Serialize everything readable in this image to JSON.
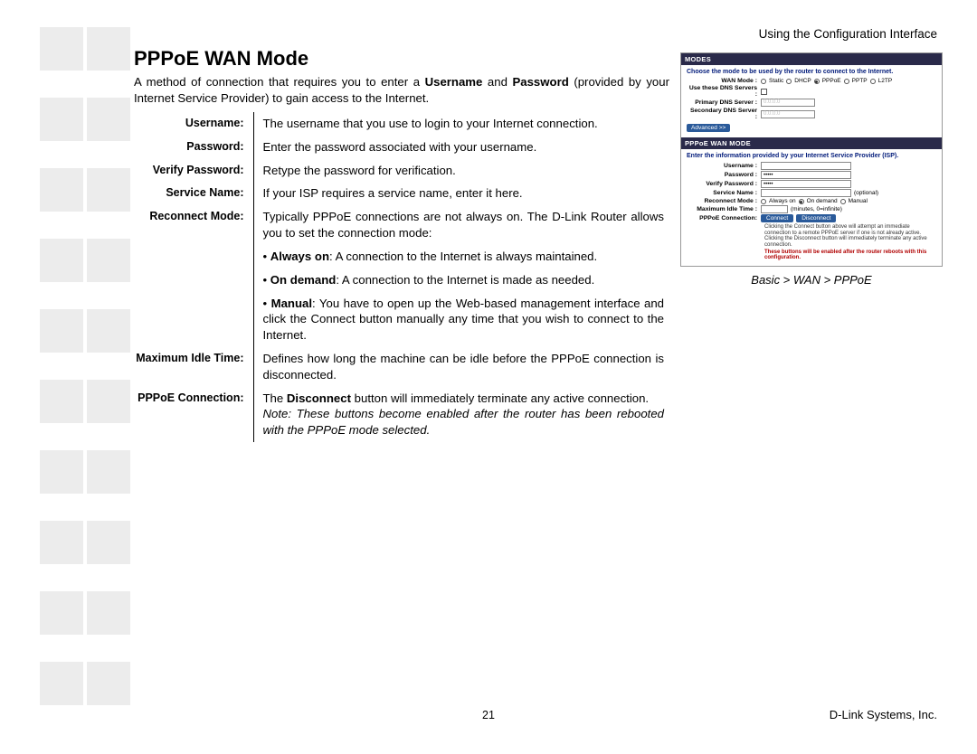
{
  "header": {
    "section": "Using the Configuration Interface"
  },
  "title": "PPPoE WAN Mode",
  "intro_parts": {
    "a": "A method of connection that requires you to enter a ",
    "b": "Username",
    "c": " and ",
    "d": "Password",
    "e": " (provided by your Internet Service Provider) to gain access to the Internet."
  },
  "defs": {
    "username": {
      "label": "Username:",
      "val": "The username that you use to login to your Internet connection."
    },
    "password": {
      "label": "Password:",
      "val": "Enter the password associated with your username."
    },
    "verify": {
      "label": "Verify Password:",
      "val": "Retype the password for verification."
    },
    "service": {
      "label": "Service Name:",
      "val": "If your ISP requires a service name, enter it here."
    },
    "reconnect": {
      "label": "Reconnect Mode:",
      "intro": "Typically PPPoE connections are not always on. The D-Link Router allows you to set the connection mode:",
      "b1_label": "Always on",
      "b1_text": ": A connection to the Internet is always maintained.",
      "b2_label": "On demand",
      "b2_text": ": A connection to the Internet is made as needed.",
      "b3_label": "Manual",
      "b3_text": ": You have to open up the Web-based management interface and click the Connect button manually any time that you wish to connect to the Internet."
    },
    "idle": {
      "label": "Maximum Idle Time:",
      "val": "Defines how long the machine can be idle before the PPPoE connection is disconnected."
    },
    "conn": {
      "label": "PPPoE Connection:",
      "a": "The ",
      "b": "Disconnect",
      "c": " button will immediately terminate any active connection.",
      "note": "Note: These buttons become enabled after the router has been rebooted with the PPPoE mode selected."
    }
  },
  "shot": {
    "modes_title": "MODES",
    "modes_instr": "Choose the mode to be used by the router to connect to the Internet.",
    "wan_mode_label": "WAN Mode :",
    "wan_options": {
      "static": "Static",
      "dhcp": "DHCP",
      "pppoe": "PPPoE",
      "pptp": "PPTP",
      "l2tp": "L2TP"
    },
    "use_dns_label": "Use these DNS Servers :",
    "pdns_label": "Primary DNS Server :",
    "sdns_label": "Secondary DNS Server :",
    "pdns_val": "0.0.0.0",
    "sdns_val": "0.0.0.0",
    "advanced": "Advanced >>",
    "pppoe_title": "PPPoE WAN MODE",
    "pppoe_instr": "Enter the information provided by your Internet Service Provider (ISP).",
    "f_user": "Username :",
    "f_pass": "Password :",
    "f_vpass": "Verify Password :",
    "f_svc": "Service Name :",
    "f_svc_hint": "(optional)",
    "f_reconnect": "Reconnect Mode :",
    "r_always": "Always on",
    "r_ondemand": "On demand",
    "r_manual": "Manual",
    "f_idle": "Maximum Idle Time :",
    "f_idle_hint": "(minutes, 0=infinite)",
    "f_conn": "PPPoE Connection:",
    "btn_connect": "Connect",
    "btn_disconnect": "Disconnect",
    "foot_note": "Clicking the Connect button above will attempt an immediate connection to a remote PPPoE server if one is not already active. Clicking the Disconnect button will immediately terminate any active connection.",
    "foot_warn": "These buttons will be enabled after the router reboots with this configuration.",
    "pass_mask": "•••••"
  },
  "caption": "Basic > WAN > PPPoE",
  "page_number": "21",
  "footer": "D-Link Systems, Inc."
}
